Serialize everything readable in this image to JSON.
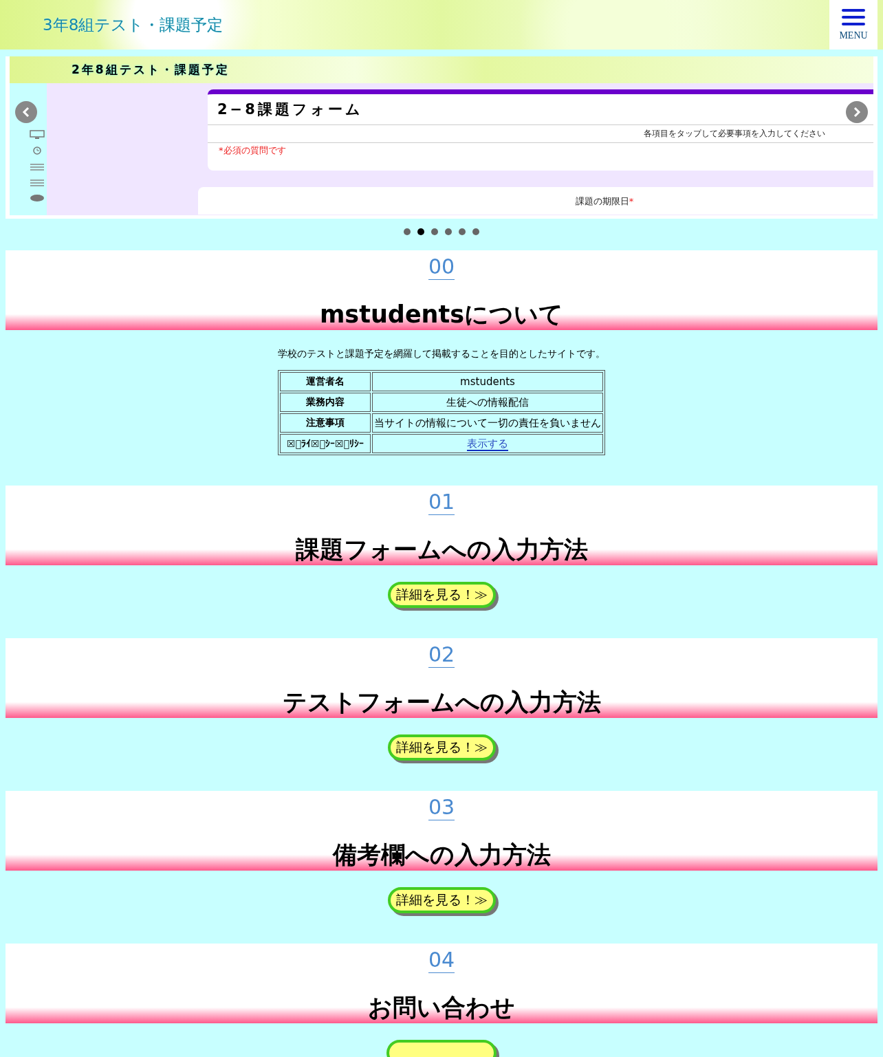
{
  "header": {
    "site_title": "3年8組テスト・課題予定",
    "menu_label": "MENU"
  },
  "slider": {
    "slide": {
      "banner_title": "2年8組テスト・課題予定",
      "form_title": "2−8課題フォーム",
      "form_hint": "各項目をタップして必要事項を入力してください",
      "required_note": "*必須の質問です",
      "question_label": "課題の期限日",
      "question_mark": "*"
    },
    "dots": [
      {
        "selected": false
      },
      {
        "selected": true
      },
      {
        "selected": false
      },
      {
        "selected": false
      },
      {
        "selected": false
      },
      {
        "selected": false
      }
    ]
  },
  "sections": [
    {
      "number": "00",
      "heading": "mstudentsについて",
      "kind": "info",
      "intro": "学校のテストと課題予定を網羅して掲載することを目的としたサイトです。",
      "table": [
        {
          "label": "運営者名",
          "value": "mstudents",
          "kind": "text"
        },
        {
          "label": "業務内容",
          "value": "生徒への情報配信",
          "kind": "text"
        },
        {
          "label": "注意事項",
          "value": "当サイトの情報について一切の責任を負いません",
          "kind": "text"
        },
        {
          "label": "☒ﾟﾗｲ☒ﾞｼｰ☒ﾟﾘｼｰ",
          "value": "表示する",
          "kind": "link"
        }
      ]
    },
    {
      "number": "01",
      "heading": "課題フォームへの入力方法",
      "kind": "button",
      "button_label": "詳細を見る！≫"
    },
    {
      "number": "02",
      "heading": "テストフォームへの入力方法",
      "kind": "button",
      "button_label": "詳細を見る！≫"
    },
    {
      "number": "03",
      "heading": "備考欄への入力方法",
      "kind": "button",
      "button_label": "詳細を見る！≫"
    },
    {
      "number": "04",
      "heading": "お問い合わせ",
      "kind": "button"
    }
  ]
}
